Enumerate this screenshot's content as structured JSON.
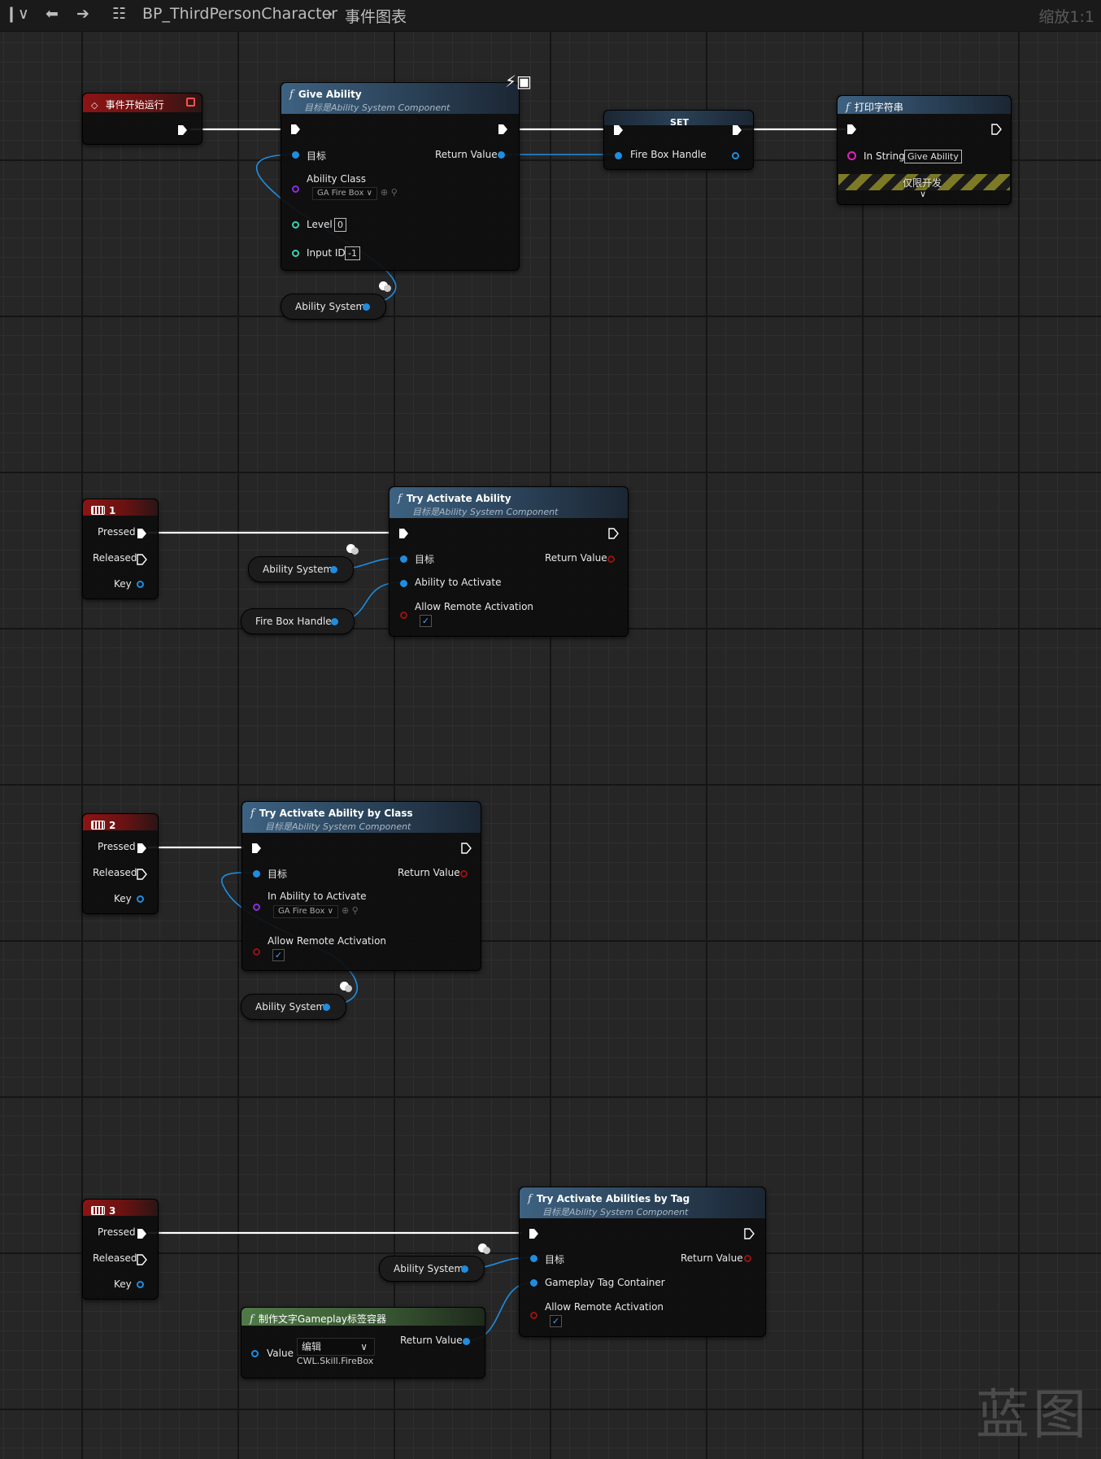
{
  "toolbar": {
    "breadcrumb_blueprint": "BP_ThirdPersonCharacter",
    "breadcrumb_graph": "事件图表",
    "zoom": "缩放1:1"
  },
  "begin_play": {
    "title": "事件开始运行"
  },
  "give_ability": {
    "title": "Give Ability",
    "subtitle": "目标是Ability System Component",
    "target": "目标",
    "return_value": "Return Value",
    "ability_class": "Ability Class",
    "ability_class_value": "GA Fire Box",
    "level": "Level",
    "level_value": "0",
    "input_id": "Input ID",
    "input_id_value": "-1"
  },
  "set_node": {
    "title": "SET",
    "var": "Fire Box Handle"
  },
  "print_string": {
    "title": "打印字符串",
    "in_string": "In String",
    "in_string_value": "Give Ability",
    "dev_only": "仅限开发"
  },
  "ability_system_label": "Ability System",
  "fire_box_handle_label": "Fire Box Handle",
  "key1": {
    "title": "1",
    "pressed": "Pressed",
    "released": "Released",
    "key": "Key"
  },
  "key2": {
    "title": "2",
    "pressed": "Pressed",
    "released": "Released",
    "key": "Key"
  },
  "key3": {
    "title": "3",
    "pressed": "Pressed",
    "released": "Released",
    "key": "Key"
  },
  "try_activate": {
    "title": "Try Activate Ability",
    "subtitle": "目标是Ability System Component",
    "target": "目标",
    "return_value": "Return Value",
    "ability_to_activate": "Ability to Activate",
    "allow_remote": "Allow Remote Activation"
  },
  "try_activate_class": {
    "title": "Try Activate Ability by Class",
    "subtitle": "目标是Ability System Component",
    "target": "目标",
    "return_value": "Return Value",
    "in_ability": "In Ability to Activate",
    "in_ability_value": "GA Fire Box",
    "allow_remote": "Allow Remote Activation"
  },
  "try_activate_tag": {
    "title": "Try Activate Abilities by Tag",
    "subtitle": "目标是Ability System Component",
    "target": "目标",
    "return_value": "Return Value",
    "tag_container": "Gameplay Tag Container",
    "allow_remote": "Allow Remote Activation"
  },
  "make_tag": {
    "title": "制作文字Gameplay标签容器",
    "value": "Value",
    "edit": "编辑",
    "return_value": "Return Value",
    "tag_value": "CWL.Skill.FireBox"
  },
  "watermark": "蓝图",
  "colors": {
    "exec_wire": "#ffffff",
    "object_wire": "#1f8de0",
    "func_header": "#3d6282",
    "event_header": "#8c1414"
  }
}
